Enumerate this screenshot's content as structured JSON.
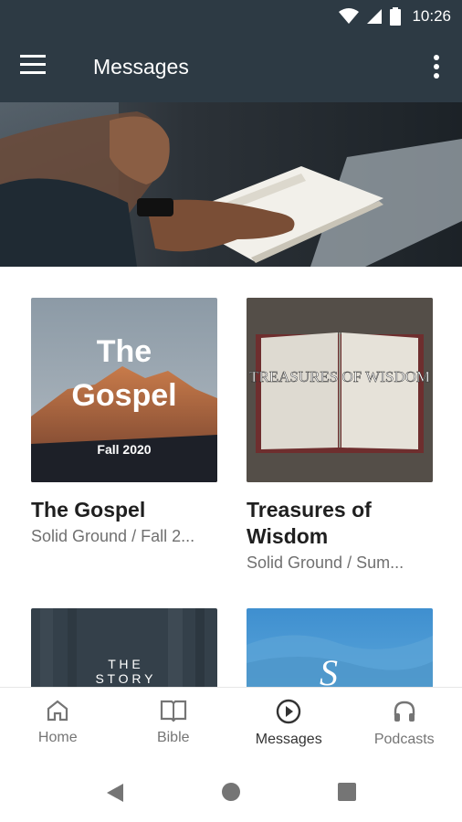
{
  "status_bar": {
    "time": "10:26"
  },
  "app_bar": {
    "title": "Messages"
  },
  "cards": [
    {
      "title": "The Gospel",
      "subtitle": "Solid Ground / Fall 2...",
      "art_line1": "The",
      "art_line2": "Gospel",
      "art_line3": "Fall 2020"
    },
    {
      "title": "Treasures of Wisdom",
      "subtitle": "Solid Ground / Sum...",
      "art_text": "TREASURES OF WISDOM"
    },
    {
      "art_line1": "T H E",
      "art_line2": "S T O R Y"
    },
    {
      "art_text": "S"
    }
  ],
  "bottom_nav": {
    "items": [
      {
        "label": "Home",
        "icon": "home-icon"
      },
      {
        "label": "Bible",
        "icon": "book-icon"
      },
      {
        "label": "Messages",
        "icon": "play-circle-icon",
        "active": true
      },
      {
        "label": "Podcasts",
        "icon": "headphones-icon"
      }
    ]
  },
  "colors": {
    "app_bar": "#2d3a44",
    "active_nav": "#333333",
    "inactive_nav": "#757575"
  }
}
